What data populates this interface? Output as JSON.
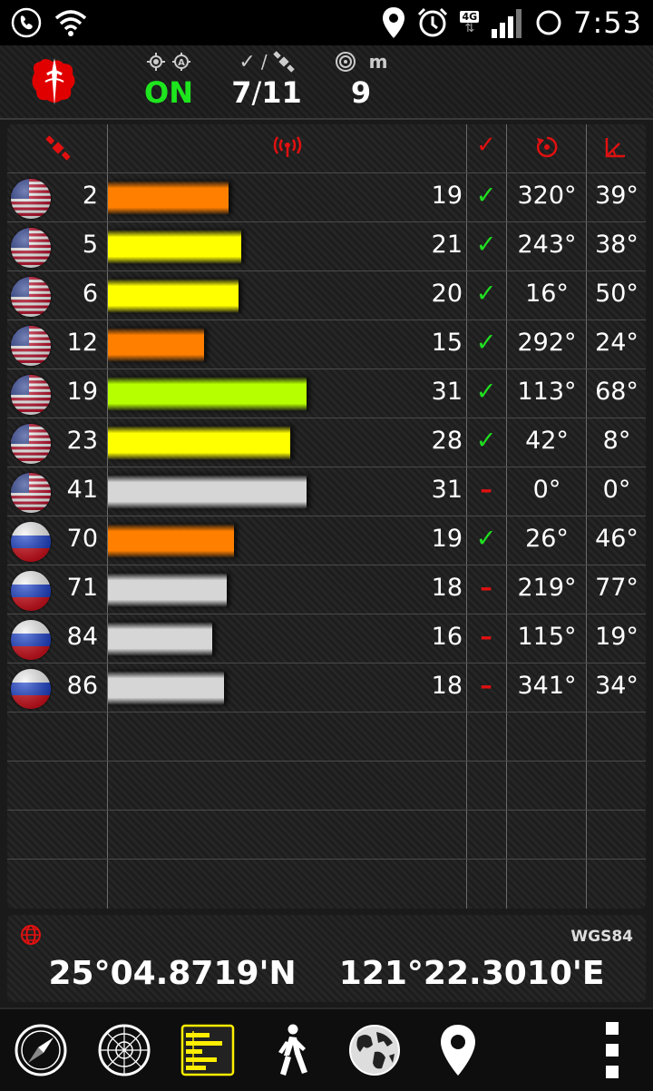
{
  "status_bar": {
    "time": "7:53",
    "network": "4G",
    "icons": [
      "phone-icon",
      "wifi-icon",
      "location-icon",
      "alarm-icon",
      "signal-icon",
      "battery-icon"
    ]
  },
  "header": {
    "fix_status": "ON",
    "satellites_used": "7",
    "satellites_separator": "/",
    "satellites_visible": "11",
    "accuracy": "9",
    "accuracy_unit": "m",
    "separator_label": "/"
  },
  "table": {
    "rows": [
      {
        "flag": "usa",
        "prn": "2",
        "snr": "19",
        "bar_pct": 0.193,
        "bar_color": "#ff7f00",
        "used": "✓",
        "used_flag": true,
        "azimuth": "320°",
        "elevation": "39°"
      },
      {
        "flag": "usa",
        "prn": "5",
        "snr": "21",
        "bar_pct": 0.213,
        "bar_color": "#ffff00",
        "used": "✓",
        "used_flag": true,
        "azimuth": "243°",
        "elevation": "38°"
      },
      {
        "flag": "usa",
        "prn": "6",
        "snr": "20",
        "bar_pct": 0.208,
        "bar_color": "#ffff00",
        "used": "✓",
        "used_flag": true,
        "azimuth": "16°",
        "elevation": "50°"
      },
      {
        "flag": "usa",
        "prn": "12",
        "snr": "15",
        "bar_pct": 0.154,
        "bar_color": "#ff7f00",
        "used": "✓",
        "used_flag": true,
        "azimuth": "292°",
        "elevation": "24°"
      },
      {
        "flag": "usa",
        "prn": "19",
        "snr": "31",
        "bar_pct": 0.317,
        "bar_color": "#b6ff00",
        "used": "✓",
        "used_flag": true,
        "azimuth": "113°",
        "elevation": "68°"
      },
      {
        "flag": "usa",
        "prn": "23",
        "snr": "28",
        "bar_pct": 0.291,
        "bar_color": "#ffff00",
        "used": "✓",
        "used_flag": true,
        "azimuth": "42°",
        "elevation": "8°"
      },
      {
        "flag": "usa",
        "prn": "41",
        "snr": "31",
        "bar_pct": 0.317,
        "bar_color": "#d6d6d6",
        "used": "–",
        "used_flag": false,
        "azimuth": "0°",
        "elevation": "0°"
      },
      {
        "flag": "rus",
        "prn": "70",
        "snr": "19",
        "bar_pct": 0.202,
        "bar_color": "#ff7f00",
        "used": "✓",
        "used_flag": true,
        "azimuth": "26°",
        "elevation": "46°"
      },
      {
        "flag": "rus",
        "prn": "71",
        "snr": "18",
        "bar_pct": 0.19,
        "bar_color": "#d6d6d6",
        "used": "–",
        "used_flag": false,
        "azimuth": "219°",
        "elevation": "77°"
      },
      {
        "flag": "rus",
        "prn": "84",
        "snr": "16",
        "bar_pct": 0.167,
        "bar_color": "#d6d6d6",
        "used": "–",
        "used_flag": false,
        "azimuth": "115°",
        "elevation": "19°"
      },
      {
        "flag": "rus",
        "prn": "86",
        "snr": "18",
        "bar_pct": 0.185,
        "bar_color": "#d6d6d6",
        "used": "–",
        "used_flag": false,
        "azimuth": "341°",
        "elevation": "34°"
      }
    ]
  },
  "coordinates": {
    "datum": "WGS84",
    "latitude": "25°04.8719'N",
    "longitude": "121°22.3010'E"
  },
  "nav": {
    "items": [
      "compass-icon",
      "radar-icon",
      "signal-bars-icon",
      "walk-icon",
      "globe-icon",
      "map-pin-icon",
      "menu-icon"
    ],
    "active": "signal-bars-icon"
  }
}
